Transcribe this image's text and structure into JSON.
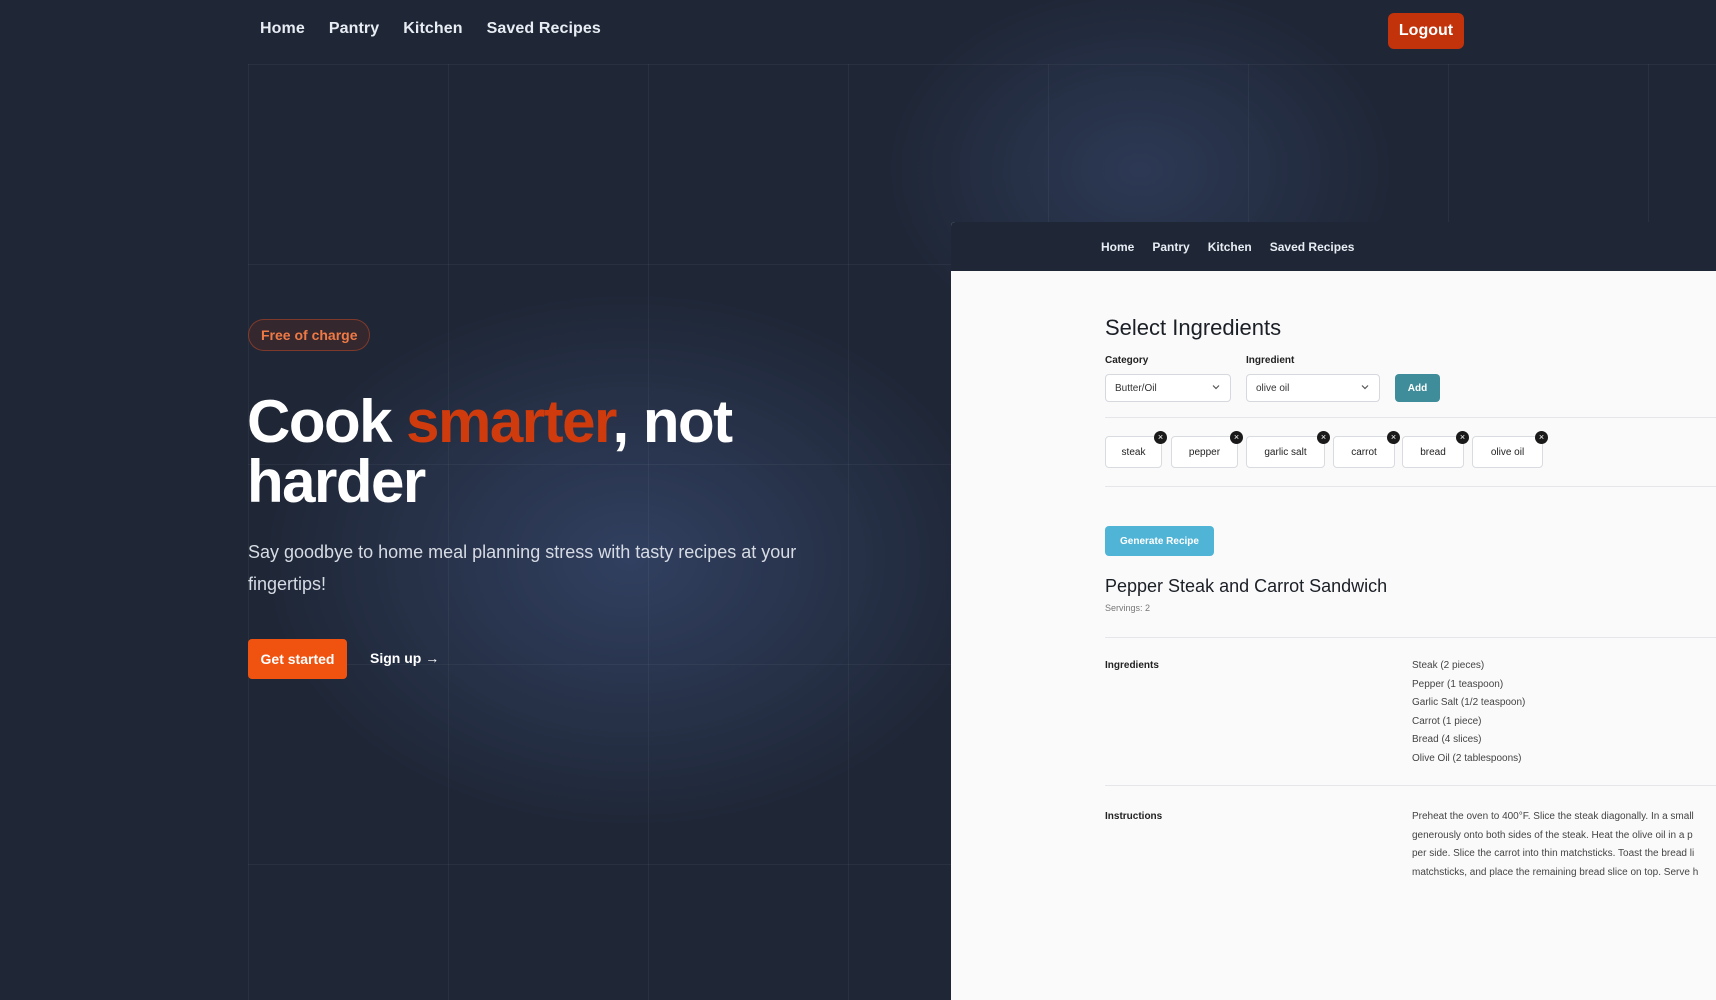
{
  "nav": {
    "items": [
      "Home",
      "Pantry",
      "Kitchen",
      "Saved Recipes"
    ],
    "logout": "Logout"
  },
  "hero": {
    "badge": "Free of charge",
    "title_part1": "Cook ",
    "title_accent": "smarter",
    "title_part2": ", not harder",
    "subtitle": "Say goodbye to home meal planning stress with tasty recipes at your fingertips!",
    "cta": "Get started",
    "signup": "Sign up →"
  },
  "colors": {
    "background": "#1f2737",
    "accent": "#cf3b0c",
    "cta": "#f0530f",
    "logout": "#c2330b",
    "add_button": "#3f8d9a",
    "generate_button": "#50b4d6"
  },
  "preview": {
    "nav": [
      "Home",
      "Pantry",
      "Kitchen",
      "Saved Recipes"
    ],
    "heading": "Select Ingredients",
    "category_label": "Category",
    "category_value": "Butter/Oil",
    "ingredient_label": "Ingredient",
    "ingredient_value": "olive oil",
    "add": "Add",
    "chips": [
      "steak",
      "pepper",
      "garlic salt",
      "carrot",
      "bread",
      "olive oil"
    ],
    "generate": "Generate Recipe",
    "recipe_title": "Pepper Steak and Carrot Sandwich",
    "servings": "Servings: 2",
    "ingredients_label": "Ingredients",
    "ingredients": [
      "Steak (2 pieces)",
      "Pepper (1 teaspoon)",
      "Garlic Salt (1/2 teaspoon)",
      "Carrot (1 piece)",
      "Bread (4 slices)",
      "Olive Oil (2 tablespoons)"
    ],
    "instructions_label": "Instructions",
    "instructions_lines": [
      "Preheat the oven to 400°F. Slice the steak diagonally. In a small",
      "generously onto both sides of the steak. Heat the olive oil in a p",
      "per side. Slice the carrot into thin matchsticks. Toast the bread li",
      "matchsticks, and place the remaining bread slice on top. Serve h"
    ]
  }
}
